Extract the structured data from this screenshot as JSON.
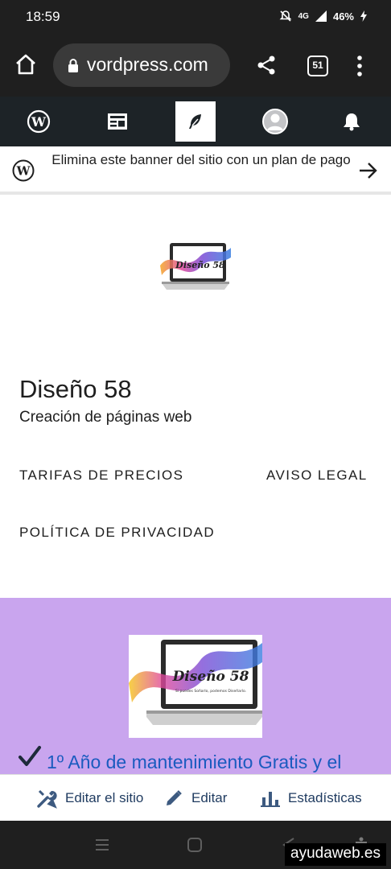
{
  "status_bar": {
    "time": "18:59",
    "network": "4G",
    "battery": "46%",
    "icons": [
      "mute-icon",
      "signal-icon",
      "battery-icon"
    ]
  },
  "browser": {
    "url": "vordpress.com",
    "tab_count": "51",
    "icons": [
      "home-icon",
      "lock-icon",
      "share-icon",
      "tabs-icon",
      "menu-icon"
    ]
  },
  "wp_toolbar": {
    "items": [
      "wordpress-icon",
      "reader-icon",
      "editor-icon",
      "avatar",
      "notifications-icon"
    ],
    "active_index": 2
  },
  "banner": {
    "text": "Elimina este banner del sitio con un plan de pago"
  },
  "site": {
    "logo_text": "Diseño 58",
    "title": "Diseño 58",
    "tagline": "Creación de páginas web",
    "nav": {
      "pricing": "TARIFAS DE PRECIOS",
      "legal": "AVISO LEGAL",
      "privacy": "POLÍTICA DE PRIVACIDAD"
    }
  },
  "hero": {
    "logo_text": "Diseño 58",
    "logo_subtext": "Si puedes Soñarlo, podemos Diseñarlo.",
    "first_item": "1º Año de mantenimiento Gratis y el"
  },
  "edit_bar": {
    "edit_site": "Editar el sitio",
    "edit": "Editar",
    "stats": "Estadísticas"
  },
  "watermark": "ayudaweb.es",
  "colors": {
    "wp_toolbar_bg": "#1d2327",
    "hero_bg": "#c9a5ee",
    "hero_text": "#1a5bbf",
    "browser_bg": "#1f1f1f"
  }
}
